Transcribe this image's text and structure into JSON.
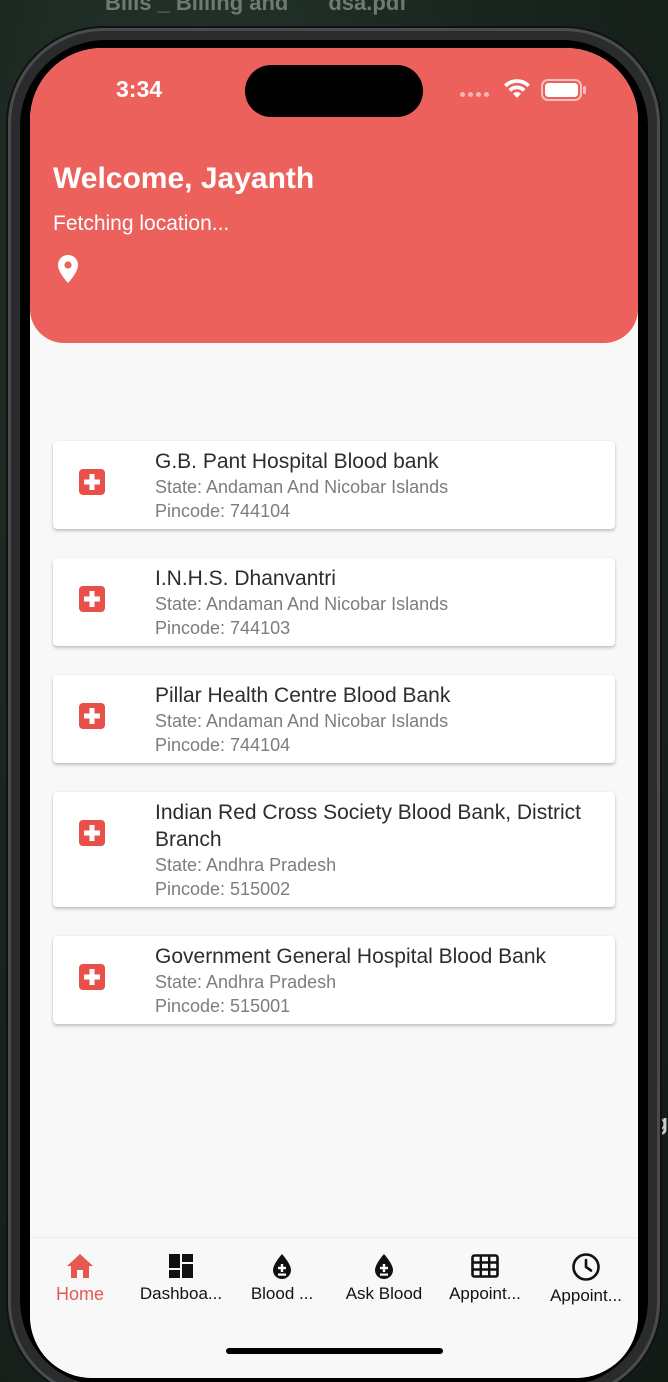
{
  "background": {
    "top_text_1": "Bills _ Billing and",
    "top_text_2": "dsa.pdf",
    "right_text": "g"
  },
  "status_bar": {
    "time": "3:34"
  },
  "header": {
    "welcome": "Welcome, Jayanth",
    "location_status": "Fetching location..."
  },
  "blood_banks": [
    {
      "name": "G.B. Pant Hospital Blood bank",
      "state": "State: Andaman And Nicobar Islands",
      "pincode": "Pincode: 744104"
    },
    {
      "name": "I.N.H.S. Dhanvantri",
      "state": "State: Andaman And Nicobar Islands",
      "pincode": "Pincode: 744103"
    },
    {
      "name": "Pillar Health Centre Blood Bank",
      "state": "State: Andaman And Nicobar Islands",
      "pincode": "Pincode: 744104"
    },
    {
      "name": "Indian Red Cross Society Blood Bank, District Branch",
      "state": "State: Andhra Pradesh",
      "pincode": "Pincode: 515002"
    },
    {
      "name": "Government General Hospital Blood Bank",
      "state": "State: Andhra Pradesh",
      "pincode": "Pincode: 515001"
    }
  ],
  "bottom_nav": [
    {
      "label": "Home",
      "icon": "home-icon",
      "active": true
    },
    {
      "label": "Dashboa...",
      "icon": "dashboard-icon",
      "active": false
    },
    {
      "label": "Blood ...",
      "icon": "blood-drop-icon",
      "active": false
    },
    {
      "label": "Ask Blood",
      "icon": "blood-drop-icon",
      "active": false
    },
    {
      "label": "Appoint...",
      "icon": "grid-icon",
      "active": false
    },
    {
      "label": "Appoint...",
      "icon": "clock-icon",
      "active": false
    }
  ],
  "colors": {
    "accent": "#ec615b",
    "active_nav": "#e45a52",
    "card_icon": "#e9504a"
  }
}
